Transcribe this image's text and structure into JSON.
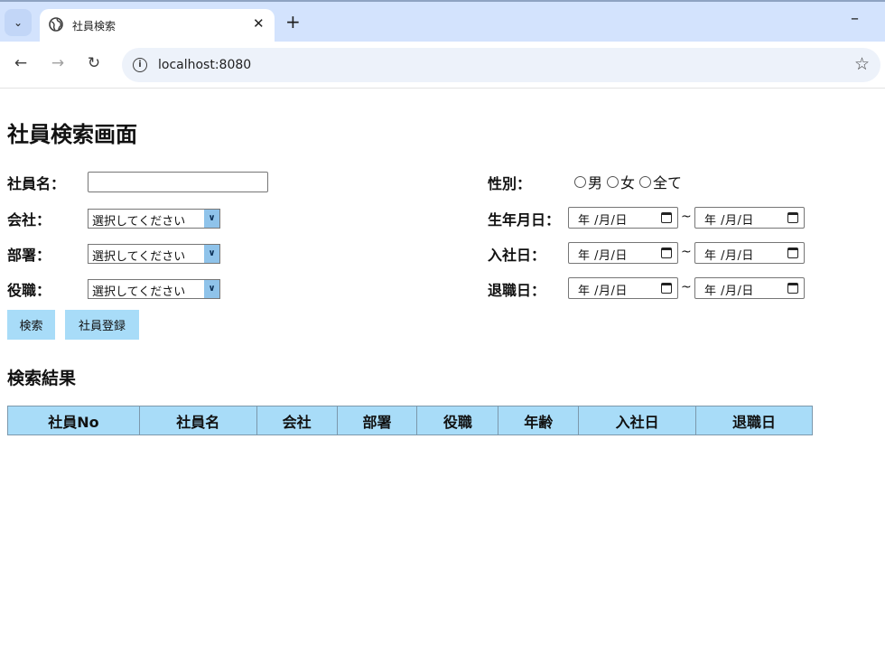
{
  "browser": {
    "tab_title": "社員検索",
    "tab_close": "✕",
    "new_tab": "+",
    "minimize": "–",
    "url": "localhost:8080"
  },
  "page": {
    "title": "社員検索画面",
    "form": {
      "employee_name_label": "社員名：",
      "company_label": "会社：",
      "department_label": "部署：",
      "position_label": "役職：",
      "select_placeholder": "選択してください",
      "gender_label": "性別：",
      "gender_options": [
        "男",
        "女",
        "全て"
      ],
      "birth_date_label": "生年月日：",
      "hire_date_label": "入社日：",
      "retire_date_label": "退職日：",
      "date_placeholder": "年 /月/日",
      "range_separator": "~"
    },
    "buttons": {
      "search": "検索",
      "register": "社員登録"
    },
    "results": {
      "title": "検索結果",
      "columns": [
        "社員No",
        "社員名",
        "会社",
        "部署",
        "役職",
        "年齢",
        "入社日",
        "退職日"
      ]
    }
  }
}
